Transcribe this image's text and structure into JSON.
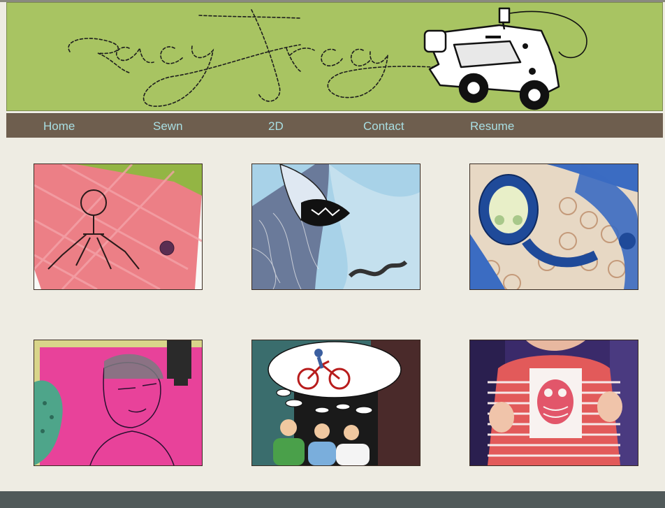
{
  "site": {
    "logo_text": "Racy Tracy"
  },
  "nav": {
    "items": [
      {
        "label": "Home"
      },
      {
        "label": "Sewn"
      },
      {
        "label": "2D"
      },
      {
        "label": "Contact"
      },
      {
        "label": "Resume"
      }
    ]
  },
  "gallery": {
    "items": [
      {
        "subject": "pink wallet with robot spider embroidery"
      },
      {
        "subject": "patterned octopus face collage"
      },
      {
        "subject": "quilted blue hooded figure"
      },
      {
        "subject": "stitched portrait on pink fabric with sewing machine foot"
      },
      {
        "subject": "comic of three people dreaming of a cyclist"
      },
      {
        "subject": "baby wearing striped onesie with owl patch"
      }
    ]
  },
  "colors": {
    "header_bg": "#a8c462",
    "nav_bg": "#6e5e4e",
    "nav_text": "#a9dfe3",
    "page_bg": "#eeece3",
    "footer_bg": "#515a5a"
  }
}
